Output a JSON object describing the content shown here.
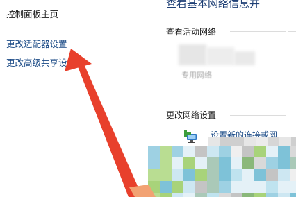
{
  "nav": {
    "home": "控制面板主页",
    "adapter_settings": "更改适配器设置",
    "advanced_sharing": "更改高级共享设置"
  },
  "main": {
    "title": "查看基本网络信息并",
    "active_networks_heading": "查看活动网络",
    "network_type": "专用网络",
    "change_settings_heading": "更改网络设置",
    "setup_connection_link": "设置新的连接或网"
  },
  "colors": {
    "link": "#1a4a86",
    "title": "#1e3f75",
    "arrow": "#e8402c"
  },
  "icons": {
    "setup": "network-setup-icon",
    "annotation": "red-arrow-annotation"
  }
}
